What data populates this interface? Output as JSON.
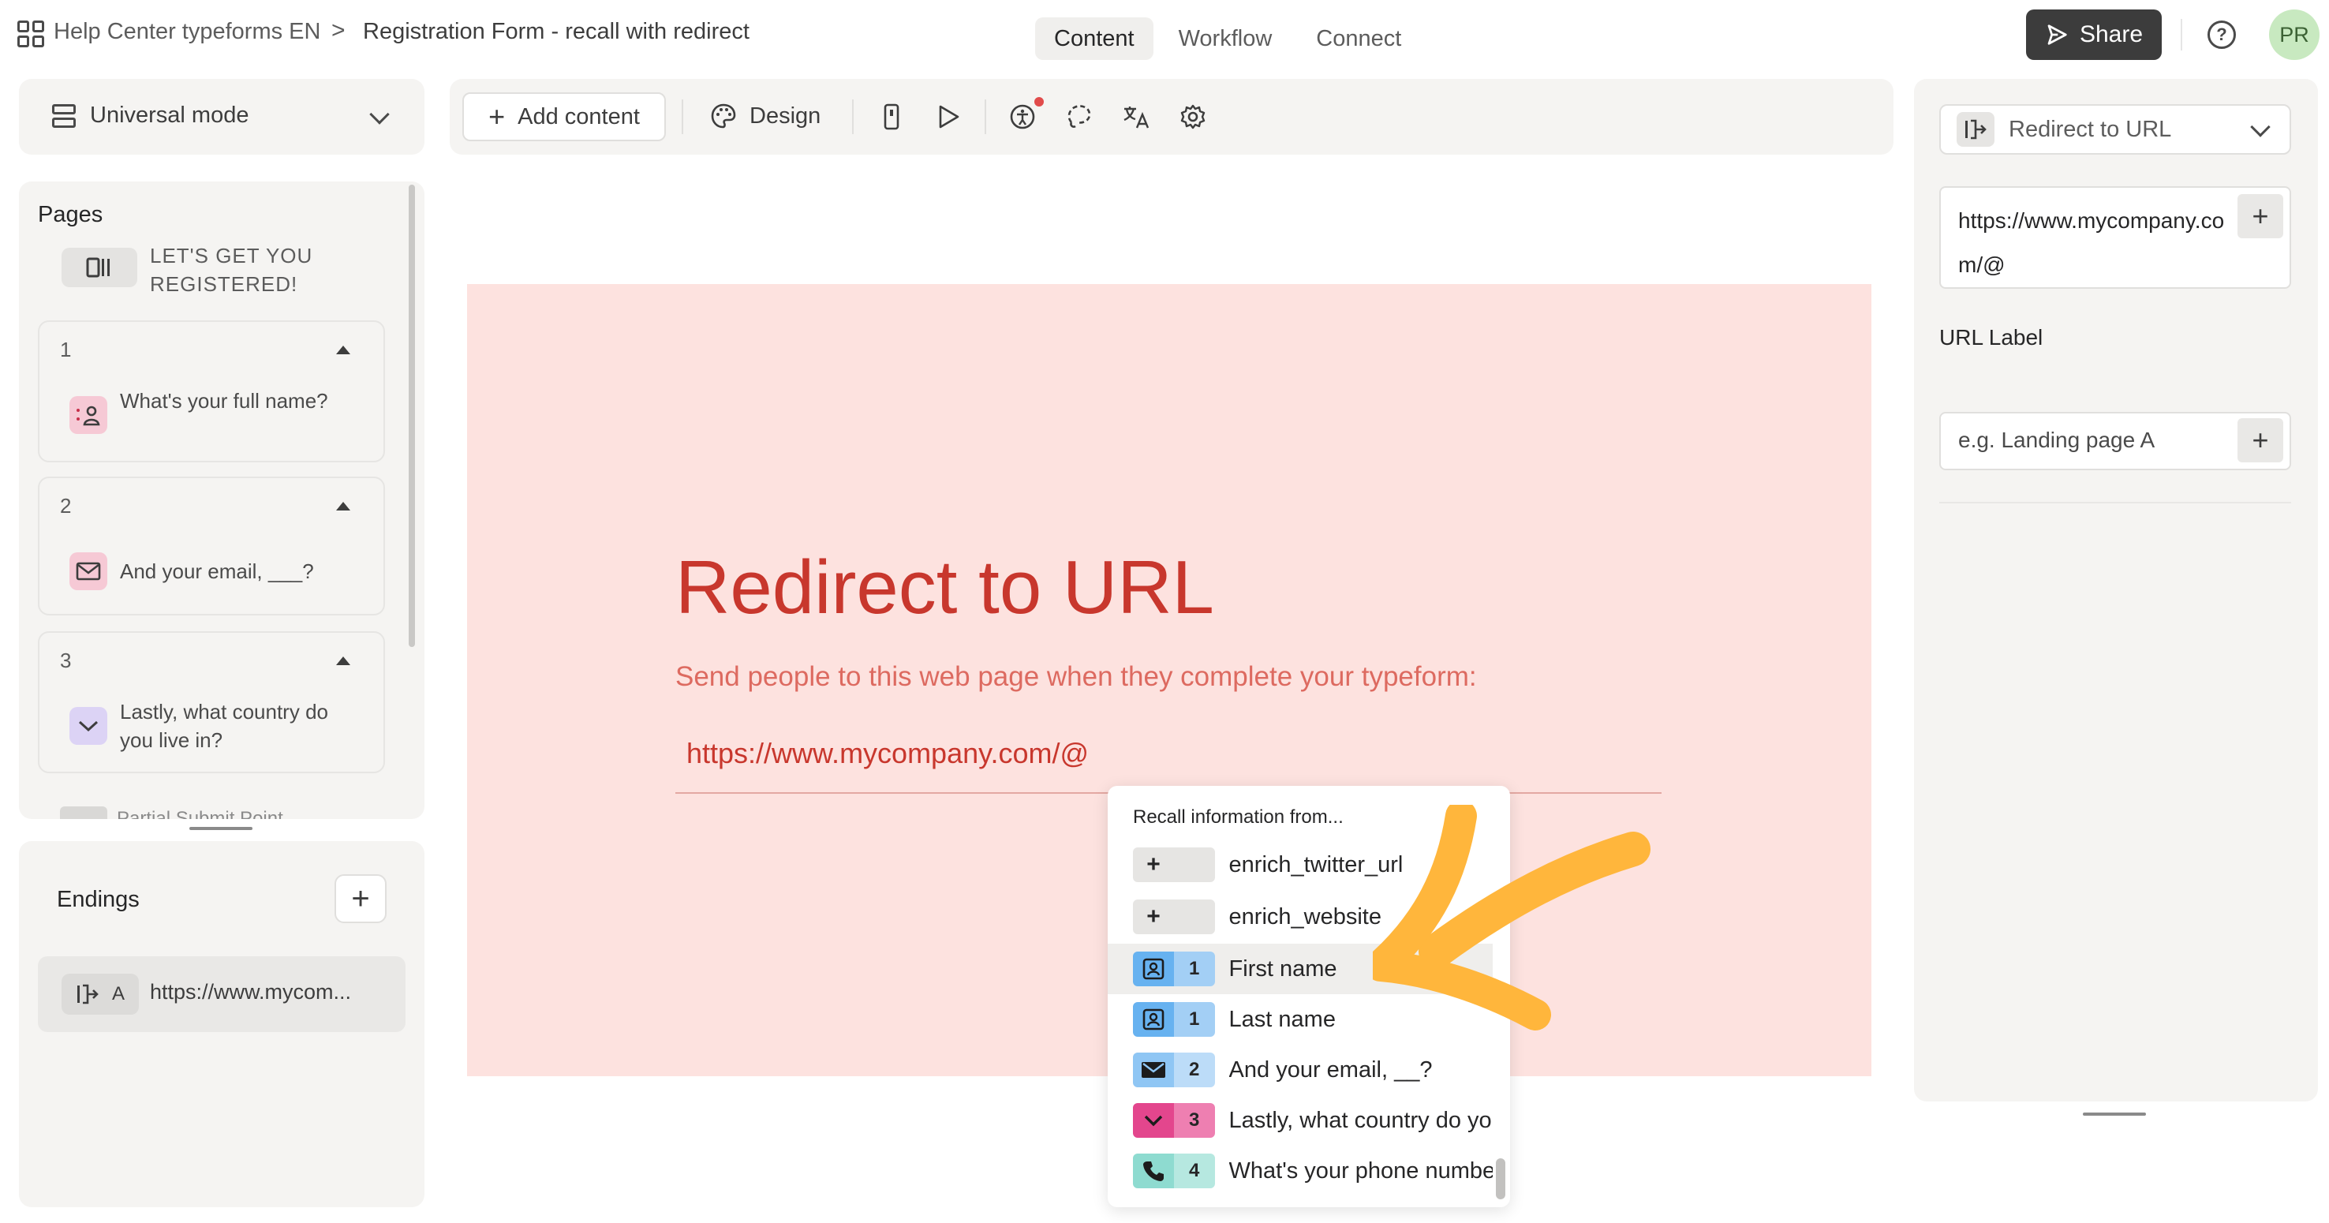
{
  "topbar": {
    "workspace": "Help Center typeforms EN",
    "separator": ">",
    "form_title": "Registration Form - recall with redirect",
    "tabs": [
      {
        "label": "Content",
        "active": true
      },
      {
        "label": "Workflow",
        "active": false
      },
      {
        "label": "Connect",
        "active": false
      }
    ],
    "share_label": "Share",
    "avatar_initials": "PR",
    "icons": {
      "apps": "grid-icon",
      "share": "send-icon",
      "help": "help-circle-icon"
    }
  },
  "mode": {
    "label": "Universal mode",
    "icon": "layout-icon"
  },
  "pages": {
    "title": "Pages",
    "welcome": "LET'S GET YOU REGISTERED!",
    "questions": [
      {
        "number": "1",
        "text": "What's your full name?",
        "icon": "contact-icon",
        "color": "#f6c9d5"
      },
      {
        "number": "2",
        "text": "And your email, ___?",
        "icon": "mail-icon",
        "color": "#f6c9d5"
      },
      {
        "number": "3",
        "text": "Lastly, what country do you live in?",
        "icon": "chevron-down-icon",
        "color": "#dcd3f5"
      }
    ],
    "partial_peek": "Partial Submit Point"
  },
  "endings": {
    "title": "Endings",
    "add_label": "+",
    "item": {
      "letter": "A",
      "text": "https://www.mycom..."
    }
  },
  "toolbar": {
    "add_content": "Add content",
    "design": "Design",
    "icons": [
      "phone-preview-icon",
      "play-icon",
      "accessibility-icon",
      "translate-icon",
      "lasso-icon",
      "settings-icon"
    ]
  },
  "canvas": {
    "background": "#fde2df",
    "title": "Redirect to URL",
    "subtitle": "Send people to this web page when they complete your typeform:",
    "url": "https://www.mycompany.com/@"
  },
  "recall": {
    "title": "Recall information from...",
    "items": [
      {
        "badge": "+",
        "number": "",
        "label": "enrich_twitter_url",
        "icon": "plus-icon",
        "color": "#e6e5e3",
        "highlight": false
      },
      {
        "badge": "+",
        "number": "",
        "label": "enrich_website",
        "icon": "plus-icon",
        "color": "#e6e5e3",
        "highlight": false
      },
      {
        "badge": "",
        "number": "1",
        "label": "First name",
        "icon": "contact-icon",
        "color": "#67b2f0",
        "highlight": true
      },
      {
        "badge": "",
        "number": "1",
        "label": "Last name",
        "icon": "contact-icon",
        "color": "#67b2f0",
        "highlight": false
      },
      {
        "badge": "",
        "number": "2",
        "label": "And your email, __?",
        "icon": "mail-icon",
        "color": "#8fc6f4",
        "highlight": false
      },
      {
        "badge": "",
        "number": "3",
        "label": "Lastly, what country do yo",
        "icon": "chevron-down-icon",
        "color": "#e3468d",
        "highlight": false
      },
      {
        "badge": "",
        "number": "4",
        "label": "What's your phone numbe",
        "icon": "phone-icon",
        "color": "#8edbd0",
        "highlight": false
      }
    ],
    "annotation_color": "#ffb63c"
  },
  "right_panel": {
    "type_label": "Redirect to URL",
    "url_value": "https://www.mycompany.com/@",
    "url_label_title": "URL Label",
    "url_label_placeholder": "e.g. Landing page A",
    "plus": "+"
  }
}
